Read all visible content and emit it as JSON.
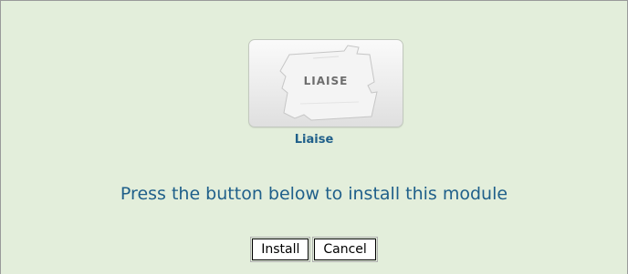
{
  "module": {
    "logo_text": "LIAISE",
    "name": "Liaise"
  },
  "instruction": "Press the button below to install this module",
  "buttons": {
    "install_label": "Install",
    "cancel_label": "Cancel"
  },
  "colors": {
    "panel_background": "#e3eedb",
    "link_text": "#1f5f8a",
    "panel_border": "#9a9a9a"
  },
  "icons": {
    "module_logo": "puzzle-piece-logo-icon"
  }
}
